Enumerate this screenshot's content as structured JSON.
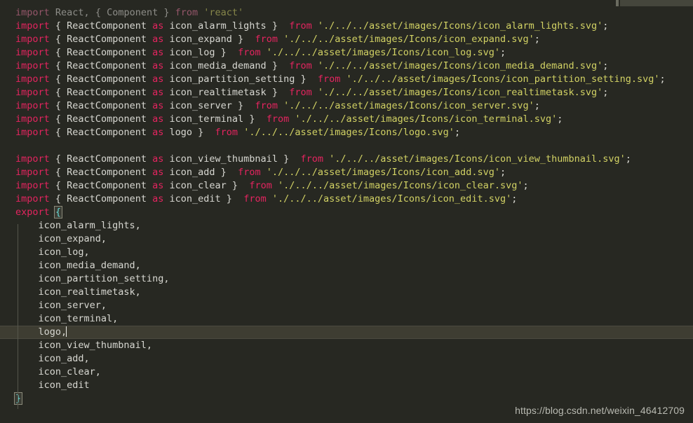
{
  "editor": {
    "theme_name": "monokai-dark",
    "colors": {
      "background": "#272822",
      "active_line": "#3e3d32",
      "keyword": "#e4245f",
      "string": "#d2d264",
      "identifier": "#d8d8d2",
      "bracket_match": "#66d9d4",
      "indent_guide": "#55564c",
      "watermark": "#b9bab2"
    },
    "caret_line_index": 21,
    "caret_column": 10
  },
  "watermark": {
    "text": "https://blog.csdn.net/weixin_46412709"
  },
  "scrollbar": {
    "vertical_thumb": "scroll-thumb",
    "minimap_slider": "minimap-slider"
  },
  "code": {
    "language": "javascript",
    "lines": [
      {
        "n": 1,
        "dim": true,
        "tokens": [
          {
            "t": "kw",
            "v": "import"
          },
          {
            "t": "sp",
            "v": " "
          },
          {
            "t": "id",
            "v": "React, { Component }"
          },
          {
            "t": "sp",
            "v": " "
          },
          {
            "t": "kw",
            "v": "from"
          },
          {
            "t": "sp",
            "v": " "
          },
          {
            "t": "str",
            "v": "'react'"
          }
        ]
      },
      {
        "n": 2,
        "dim": false,
        "tokens": [
          {
            "t": "kw",
            "v": "import"
          },
          {
            "t": "punc",
            "v": " { "
          },
          {
            "t": "id",
            "v": "ReactComponent"
          },
          {
            "t": "sp",
            "v": " "
          },
          {
            "t": "kw",
            "v": "as"
          },
          {
            "t": "sp",
            "v": " "
          },
          {
            "t": "id",
            "v": "icon_alarm_lights"
          },
          {
            "t": "punc",
            "v": " }  "
          },
          {
            "t": "kw",
            "v": "from"
          },
          {
            "t": "sp",
            "v": " "
          },
          {
            "t": "str",
            "v": "'./../../asset/images/Icons/icon_alarm_lights.svg'"
          },
          {
            "t": "punc",
            "v": ";"
          }
        ]
      },
      {
        "n": 3,
        "dim": false,
        "tokens": [
          {
            "t": "kw",
            "v": "import"
          },
          {
            "t": "punc",
            "v": " { "
          },
          {
            "t": "id",
            "v": "ReactComponent"
          },
          {
            "t": "sp",
            "v": " "
          },
          {
            "t": "kw",
            "v": "as"
          },
          {
            "t": "sp",
            "v": " "
          },
          {
            "t": "id",
            "v": "icon_expand"
          },
          {
            "t": "punc",
            "v": " }  "
          },
          {
            "t": "kw",
            "v": "from"
          },
          {
            "t": "sp",
            "v": " "
          },
          {
            "t": "str",
            "v": "'./../../asset/images/Icons/icon_expand.svg'"
          },
          {
            "t": "punc",
            "v": ";"
          }
        ]
      },
      {
        "n": 4,
        "dim": false,
        "tokens": [
          {
            "t": "kw",
            "v": "import"
          },
          {
            "t": "punc",
            "v": " { "
          },
          {
            "t": "id",
            "v": "ReactComponent"
          },
          {
            "t": "sp",
            "v": " "
          },
          {
            "t": "kw",
            "v": "as"
          },
          {
            "t": "sp",
            "v": " "
          },
          {
            "t": "id",
            "v": "icon_log"
          },
          {
            "t": "punc",
            "v": " }  "
          },
          {
            "t": "kw",
            "v": "from"
          },
          {
            "t": "sp",
            "v": " "
          },
          {
            "t": "str",
            "v": "'./../../asset/images/Icons/icon_log.svg'"
          },
          {
            "t": "punc",
            "v": ";"
          }
        ]
      },
      {
        "n": 5,
        "dim": false,
        "tokens": [
          {
            "t": "kw",
            "v": "import"
          },
          {
            "t": "punc",
            "v": " { "
          },
          {
            "t": "id",
            "v": "ReactComponent"
          },
          {
            "t": "sp",
            "v": " "
          },
          {
            "t": "kw",
            "v": "as"
          },
          {
            "t": "sp",
            "v": " "
          },
          {
            "t": "id",
            "v": "icon_media_demand"
          },
          {
            "t": "punc",
            "v": " }  "
          },
          {
            "t": "kw",
            "v": "from"
          },
          {
            "t": "sp",
            "v": " "
          },
          {
            "t": "str",
            "v": "'./../../asset/images/Icons/icon_media_demand.svg'"
          },
          {
            "t": "punc",
            "v": ";"
          }
        ]
      },
      {
        "n": 6,
        "dim": false,
        "tokens": [
          {
            "t": "kw",
            "v": "import"
          },
          {
            "t": "punc",
            "v": " { "
          },
          {
            "t": "id",
            "v": "ReactComponent"
          },
          {
            "t": "sp",
            "v": " "
          },
          {
            "t": "kw",
            "v": "as"
          },
          {
            "t": "sp",
            "v": " "
          },
          {
            "t": "id",
            "v": "icon_partition_setting"
          },
          {
            "t": "punc",
            "v": " }  "
          },
          {
            "t": "kw",
            "v": "from"
          },
          {
            "t": "sp",
            "v": " "
          },
          {
            "t": "str",
            "v": "'./../../asset/images/Icons/icon_partition_setting.svg'"
          },
          {
            "t": "punc",
            "v": ";"
          }
        ]
      },
      {
        "n": 7,
        "dim": false,
        "tokens": [
          {
            "t": "kw",
            "v": "import"
          },
          {
            "t": "punc",
            "v": " { "
          },
          {
            "t": "id",
            "v": "ReactComponent"
          },
          {
            "t": "sp",
            "v": " "
          },
          {
            "t": "kw",
            "v": "as"
          },
          {
            "t": "sp",
            "v": " "
          },
          {
            "t": "id",
            "v": "icon_realtimetask"
          },
          {
            "t": "punc",
            "v": " }  "
          },
          {
            "t": "kw",
            "v": "from"
          },
          {
            "t": "sp",
            "v": " "
          },
          {
            "t": "str",
            "v": "'./../../asset/images/Icons/icon_realtimetask.svg'"
          },
          {
            "t": "punc",
            "v": ";"
          }
        ]
      },
      {
        "n": 8,
        "dim": false,
        "tokens": [
          {
            "t": "kw",
            "v": "import"
          },
          {
            "t": "punc",
            "v": " { "
          },
          {
            "t": "id",
            "v": "ReactComponent"
          },
          {
            "t": "sp",
            "v": " "
          },
          {
            "t": "kw",
            "v": "as"
          },
          {
            "t": "sp",
            "v": " "
          },
          {
            "t": "id",
            "v": "icon_server"
          },
          {
            "t": "punc",
            "v": " }  "
          },
          {
            "t": "kw",
            "v": "from"
          },
          {
            "t": "sp",
            "v": " "
          },
          {
            "t": "str",
            "v": "'./../../asset/images/Icons/icon_server.svg'"
          },
          {
            "t": "punc",
            "v": ";"
          }
        ]
      },
      {
        "n": 9,
        "dim": false,
        "tokens": [
          {
            "t": "kw",
            "v": "import"
          },
          {
            "t": "punc",
            "v": " { "
          },
          {
            "t": "id",
            "v": "ReactComponent"
          },
          {
            "t": "sp",
            "v": " "
          },
          {
            "t": "kw",
            "v": "as"
          },
          {
            "t": "sp",
            "v": " "
          },
          {
            "t": "id",
            "v": "icon_terminal"
          },
          {
            "t": "punc",
            "v": " }  "
          },
          {
            "t": "kw",
            "v": "from"
          },
          {
            "t": "sp",
            "v": " "
          },
          {
            "t": "str",
            "v": "'./../../asset/images/Icons/icon_terminal.svg'"
          },
          {
            "t": "punc",
            "v": ";"
          }
        ]
      },
      {
        "n": 10,
        "dim": false,
        "tokens": [
          {
            "t": "kw",
            "v": "import"
          },
          {
            "t": "punc",
            "v": " { "
          },
          {
            "t": "id",
            "v": "ReactComponent"
          },
          {
            "t": "sp",
            "v": " "
          },
          {
            "t": "kw",
            "v": "as"
          },
          {
            "t": "sp",
            "v": " "
          },
          {
            "t": "id",
            "v": "logo"
          },
          {
            "t": "punc",
            "v": " }  "
          },
          {
            "t": "kw",
            "v": "from"
          },
          {
            "t": "sp",
            "v": " "
          },
          {
            "t": "str",
            "v": "'./../../asset/images/Icons/logo.svg'"
          },
          {
            "t": "punc",
            "v": ";"
          }
        ]
      },
      {
        "n": 11,
        "dim": false,
        "tokens": []
      },
      {
        "n": 12,
        "dim": false,
        "tokens": [
          {
            "t": "kw",
            "v": "import"
          },
          {
            "t": "punc",
            "v": " { "
          },
          {
            "t": "id",
            "v": "ReactComponent"
          },
          {
            "t": "sp",
            "v": " "
          },
          {
            "t": "kw",
            "v": "as"
          },
          {
            "t": "sp",
            "v": " "
          },
          {
            "t": "id",
            "v": "icon_view_thumbnail"
          },
          {
            "t": "punc",
            "v": " }  "
          },
          {
            "t": "kw",
            "v": "from"
          },
          {
            "t": "sp",
            "v": " "
          },
          {
            "t": "str",
            "v": "'./../../asset/images/Icons/icon_view_thumbnail.svg'"
          },
          {
            "t": "punc",
            "v": ";"
          }
        ]
      },
      {
        "n": 13,
        "dim": false,
        "tokens": [
          {
            "t": "kw",
            "v": "import"
          },
          {
            "t": "punc",
            "v": " { "
          },
          {
            "t": "id",
            "v": "ReactComponent"
          },
          {
            "t": "sp",
            "v": " "
          },
          {
            "t": "kw",
            "v": "as"
          },
          {
            "t": "sp",
            "v": " "
          },
          {
            "t": "id",
            "v": "icon_add"
          },
          {
            "t": "punc",
            "v": " }  "
          },
          {
            "t": "kw",
            "v": "from"
          },
          {
            "t": "sp",
            "v": " "
          },
          {
            "t": "str",
            "v": "'./../../asset/images/Icons/icon_add.svg'"
          },
          {
            "t": "punc",
            "v": ";"
          }
        ]
      },
      {
        "n": 14,
        "dim": false,
        "tokens": [
          {
            "t": "kw",
            "v": "import"
          },
          {
            "t": "punc",
            "v": " { "
          },
          {
            "t": "id",
            "v": "ReactComponent"
          },
          {
            "t": "sp",
            "v": " "
          },
          {
            "t": "kw",
            "v": "as"
          },
          {
            "t": "sp",
            "v": " "
          },
          {
            "t": "id",
            "v": "icon_clear"
          },
          {
            "t": "punc",
            "v": " }  "
          },
          {
            "t": "kw",
            "v": "from"
          },
          {
            "t": "sp",
            "v": " "
          },
          {
            "t": "str",
            "v": "'./../../asset/images/Icons/icon_clear.svg'"
          },
          {
            "t": "punc",
            "v": ";"
          }
        ]
      },
      {
        "n": 15,
        "dim": false,
        "tokens": [
          {
            "t": "kw",
            "v": "import"
          },
          {
            "t": "punc",
            "v": " { "
          },
          {
            "t": "id",
            "v": "ReactComponent"
          },
          {
            "t": "sp",
            "v": " "
          },
          {
            "t": "kw",
            "v": "as"
          },
          {
            "t": "sp",
            "v": " "
          },
          {
            "t": "id",
            "v": "icon_edit"
          },
          {
            "t": "punc",
            "v": " }  "
          },
          {
            "t": "kw",
            "v": "from"
          },
          {
            "t": "sp",
            "v": " "
          },
          {
            "t": "str",
            "v": "'./../../asset/images/Icons/icon_edit.svg'"
          },
          {
            "t": "punc",
            "v": ";"
          }
        ]
      },
      {
        "n": 16,
        "dim": false,
        "tokens": [
          {
            "t": "kw",
            "v": "export"
          },
          {
            "t": "sp",
            "v": " "
          },
          {
            "t": "match",
            "v": "{"
          }
        ]
      },
      {
        "n": 17,
        "dim": false,
        "tokens": [
          {
            "t": "id",
            "v": "    icon_alarm_lights,"
          }
        ]
      },
      {
        "n": 18,
        "dim": false,
        "tokens": [
          {
            "t": "id",
            "v": "    icon_expand,"
          }
        ]
      },
      {
        "n": 19,
        "dim": false,
        "tokens": [
          {
            "t": "id",
            "v": "    icon_log,"
          }
        ]
      },
      {
        "n": 20,
        "dim": false,
        "tokens": [
          {
            "t": "id",
            "v": "    icon_media_demand,"
          }
        ]
      },
      {
        "n": 21,
        "dim": false,
        "tokens": [
          {
            "t": "id",
            "v": "    icon_partition_setting,"
          }
        ]
      },
      {
        "n": 22,
        "dim": false,
        "tokens": [
          {
            "t": "id",
            "v": "    icon_realtimetask,"
          }
        ]
      },
      {
        "n": 23,
        "dim": false,
        "tokens": [
          {
            "t": "id",
            "v": "    icon_server,"
          }
        ]
      },
      {
        "n": 24,
        "dim": false,
        "tokens": [
          {
            "t": "id",
            "v": "    icon_terminal,"
          }
        ]
      },
      {
        "n": 25,
        "dim": false,
        "active": true,
        "tokens": [
          {
            "t": "id",
            "v": "    logo,"
          },
          {
            "t": "caret",
            "v": ""
          }
        ]
      },
      {
        "n": 26,
        "dim": false,
        "tokens": [
          {
            "t": "id",
            "v": "    icon_view_thumbnail,"
          }
        ]
      },
      {
        "n": 27,
        "dim": false,
        "tokens": [
          {
            "t": "id",
            "v": "    icon_add,"
          }
        ]
      },
      {
        "n": 28,
        "dim": false,
        "tokens": [
          {
            "t": "id",
            "v": "    icon_clear,"
          }
        ]
      },
      {
        "n": 29,
        "dim": false,
        "tokens": [
          {
            "t": "id",
            "v": "    icon_edit"
          }
        ]
      },
      {
        "n": 30,
        "dim": false,
        "tokens": [
          {
            "t": "match",
            "v": "}"
          }
        ]
      }
    ]
  }
}
